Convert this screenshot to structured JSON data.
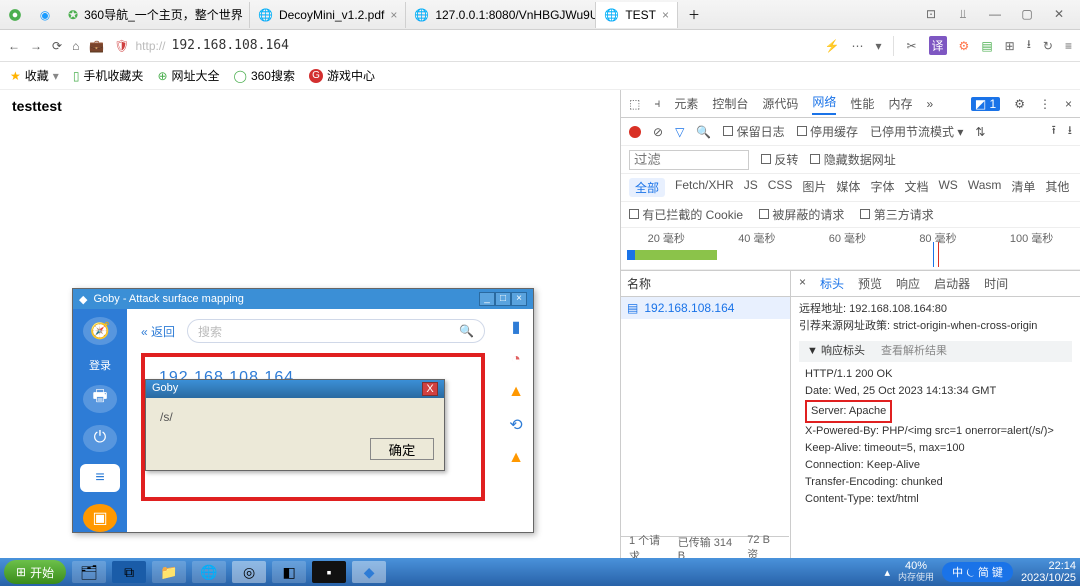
{
  "tabs": [
    {
      "label": "360导航_一个主页，整个世界",
      "active": false
    },
    {
      "label": "DecoyMini_v1.2.pdf",
      "active": false
    },
    {
      "label": "127.0.0.1:8080/VnHBGJWu9Uh",
      "active": false
    },
    {
      "label": "TEST",
      "active": true
    }
  ],
  "addressbar": {
    "url": "192.168.108.164",
    "prefix": "http://"
  },
  "bookmarks": {
    "fav": "收藏",
    "items": [
      "手机收藏夹",
      "网址大全",
      "360搜索",
      "游戏中心"
    ]
  },
  "page": {
    "bodytext": "testtest"
  },
  "goby": {
    "title": "Goby - Attack surface mapping",
    "back": "« 返回",
    "search_ph": "搜索",
    "login": "登录",
    "ip": "192.168.108.164",
    "alert": {
      "title": "Goby",
      "msg": "/s/",
      "ok": "确定"
    }
  },
  "devtools": {
    "tabs": [
      "元素",
      "控制台",
      "源代码",
      "网络",
      "性能",
      "内存"
    ],
    "active_tab": "网络",
    "badge": "◩ 1",
    "toolbar": {
      "preserve": "保留日志",
      "disable_cache": "停用缓存",
      "throttle": "已停用节流模式"
    },
    "filter_ph": "过滤",
    "invert": "反转",
    "hide_data": "隐藏数据网址",
    "types": [
      "全部",
      "Fetch/XHR",
      "JS",
      "CSS",
      "图片",
      "媒体",
      "字体",
      "文档",
      "WS",
      "Wasm",
      "清单",
      "其他"
    ],
    "cookie_row": [
      "有已拦截的 Cookie",
      "被屏蔽的请求",
      "第三方请求"
    ],
    "timeline": [
      "20 毫秒",
      "40 毫秒",
      "60 毫秒",
      "80 毫秒",
      "100 毫秒"
    ],
    "names_hdr": "名称",
    "request_name": "192.168.108.164",
    "detail_tabs": [
      "×",
      "标头",
      "预览",
      "响应",
      "启动器",
      "时间"
    ],
    "remote_label": "远程地址:",
    "remote_val": "192.168.108.164:80",
    "referrer_label": "引荐来源网址政策:",
    "referrer_val": "strict-origin-when-cross-origin",
    "resp_hdr": "响应标头",
    "view_parsed": "查看解析结果",
    "headers": [
      "HTTP/1.1 200 OK",
      "Date: Wed, 25 Oct 2023 14:13:34 GMT",
      "Server: Apache",
      "X-Powered-By: PHP/<img  src=1   onerror=alert(/s/)>",
      "Keep-Alive: timeout=5, max=100",
      "Connection: Keep-Alive",
      "Transfer-Encoding: chunked",
      "Content-Type: text/html"
    ],
    "status": {
      "reqs": "1 个请求",
      "xfer": "已传输 314 B",
      "res": "72 B 资"
    }
  },
  "taskbar": {
    "start": "开始",
    "tray": {
      "mem_pct": "40%",
      "mem_lbl": "内存使用"
    },
    "ime": "中 ⏾ 简 键",
    "clock": {
      "t": "22:14",
      "d": "2023/10/25"
    }
  }
}
